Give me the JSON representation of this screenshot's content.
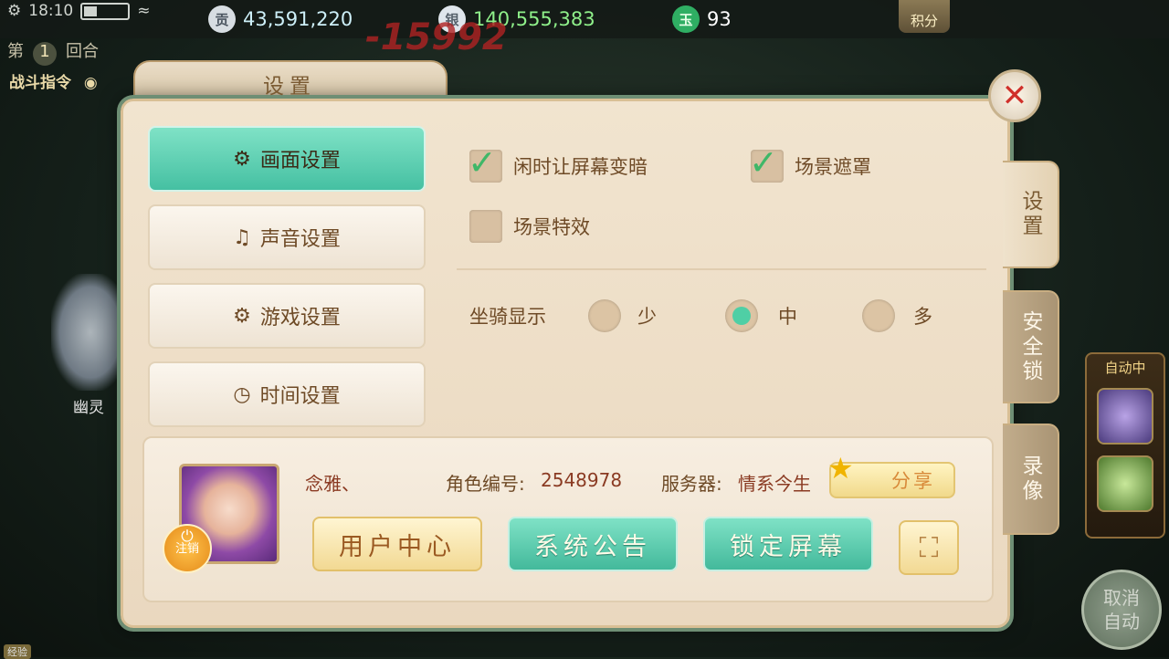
{
  "status_bar": {
    "time": "18:10"
  },
  "resources": [
    {
      "icon": "contribution-coin-icon",
      "glyph": "贡",
      "value": "43,591,220",
      "color": "#cdeff8"
    },
    {
      "icon": "silver-ingot-icon",
      "glyph": "银",
      "value": "140,555,383",
      "color": "#8ff08a"
    },
    {
      "icon": "jade-gem-icon",
      "glyph": "玉",
      "value": "93",
      "color": "#ffffff"
    }
  ],
  "score_button": "积分",
  "battle": {
    "round_prefix": "第",
    "round_number": "1",
    "round_suffix": "回合",
    "command_label": "战斗指令",
    "damage": "-15992",
    "ghost_name": "幽灵"
  },
  "dialog": {
    "title": "设置",
    "close_glyph": "✕",
    "side_tabs": [
      "设置",
      "安全锁",
      "录像"
    ],
    "menu": [
      {
        "label": "画面设置",
        "icon": "⚙"
      },
      {
        "label": "声音设置",
        "icon": "♫"
      },
      {
        "label": "游戏设置",
        "icon": "⚙"
      },
      {
        "label": "时间设置",
        "icon": "◷"
      }
    ],
    "options": {
      "dim_screen": {
        "label": "闲时让屏幕变暗",
        "checked": true
      },
      "scene_mask": {
        "label": "场景遮罩",
        "checked": true
      },
      "scene_effects": {
        "label": "场景特效",
        "checked": false
      }
    },
    "mount_display": {
      "label": "坐骑显示",
      "choices": [
        "少",
        "中",
        "多"
      ],
      "selected": "中"
    },
    "profile": {
      "name": "念雅、",
      "role_id_label": "角色编号:",
      "role_id": "2548978",
      "server_label": "服务器:",
      "server": "情系今生",
      "logout": "注销",
      "share": "分享"
    },
    "buttons": {
      "user_center": "用户中心",
      "announcement": "系统公告",
      "lock_screen": "锁定屏幕"
    }
  },
  "right_panel": {
    "auto_title": "自动中",
    "cancel_auto": "取消自动"
  },
  "exp_label": "经验"
}
